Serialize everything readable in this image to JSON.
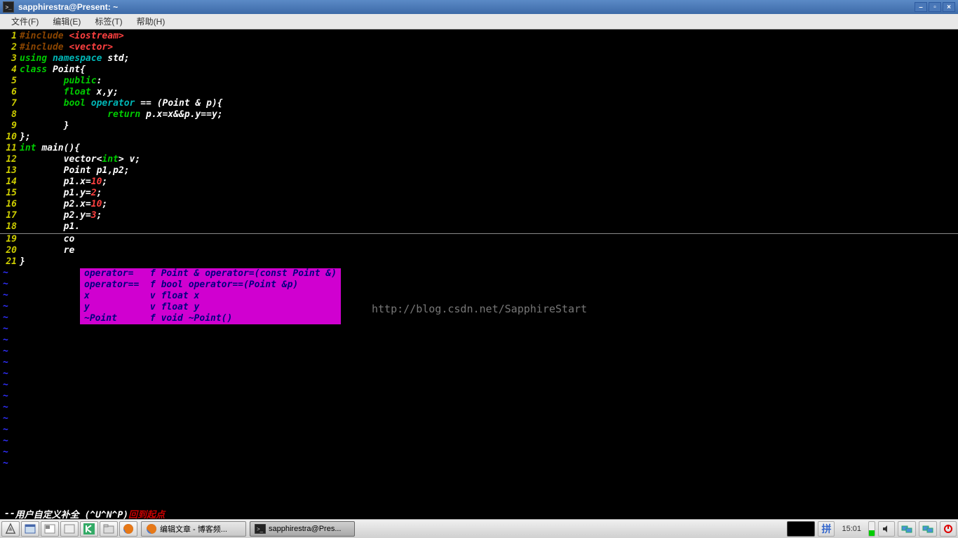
{
  "window": {
    "title": "sapphirestra@Present: ~"
  },
  "menu": {
    "file": "文件(F)",
    "edit": "编辑(E)",
    "tabs": "标签(T)",
    "help": "帮助(H)"
  },
  "code": {
    "lines": [
      {
        "n": "1",
        "t": "#include <iostream>"
      },
      {
        "n": "2",
        "t": "#include <vector>"
      },
      {
        "n": "3",
        "t": "using namespace std;"
      },
      {
        "n": "4",
        "t": "class Point{"
      },
      {
        "n": "5",
        "t": "        public:"
      },
      {
        "n": "6",
        "t": "        float x,y;"
      },
      {
        "n": "7",
        "t": "        bool operator == (Point & p){"
      },
      {
        "n": "8",
        "t": "                return p.x=x&&p.y==y;"
      },
      {
        "n": "9",
        "t": "        }"
      },
      {
        "n": "10",
        "t": "};"
      },
      {
        "n": "11",
        "t": "int main(){"
      },
      {
        "n": "12",
        "t": "        vector<int> v;"
      },
      {
        "n": "13",
        "t": "        Point p1,p2;"
      },
      {
        "n": "14",
        "t": "        p1.x=10;"
      },
      {
        "n": "15",
        "t": "        p1.y=2;"
      },
      {
        "n": "16",
        "t": "        p2.x=10;"
      },
      {
        "n": "17",
        "t": "        p2.y=3;"
      },
      {
        "n": "18",
        "t": "        p1."
      },
      {
        "n": "19",
        "t": "        co"
      },
      {
        "n": "20",
        "t": "        re"
      },
      {
        "n": "21",
        "t": "}"
      }
    ]
  },
  "completion": {
    "items": [
      {
        "name": "operator=  ",
        "kind": "f",
        "sig": "Point & operator=(const Point &)"
      },
      {
        "name": "operator== ",
        "kind": "f",
        "sig": "bool operator==(Point &p)"
      },
      {
        "name": "x          ",
        "kind": "v",
        "sig": "float x"
      },
      {
        "name": "y          ",
        "kind": "v",
        "sig": "float y"
      },
      {
        "name": "~Point     ",
        "kind": "f",
        "sig": "void ~Point()"
      }
    ]
  },
  "watermark": "http://blog.csdn.net/SapphireStart",
  "status": {
    "prefix": "-- ",
    "main": "用户自定义补全 (^U^N^P) ",
    "suffix": "回到起点"
  },
  "taskbar": {
    "task1": "编辑文章 - 博客频...",
    "task2": "sapphirestra@Pres...",
    "ime": "拼",
    "time": "15:01"
  }
}
